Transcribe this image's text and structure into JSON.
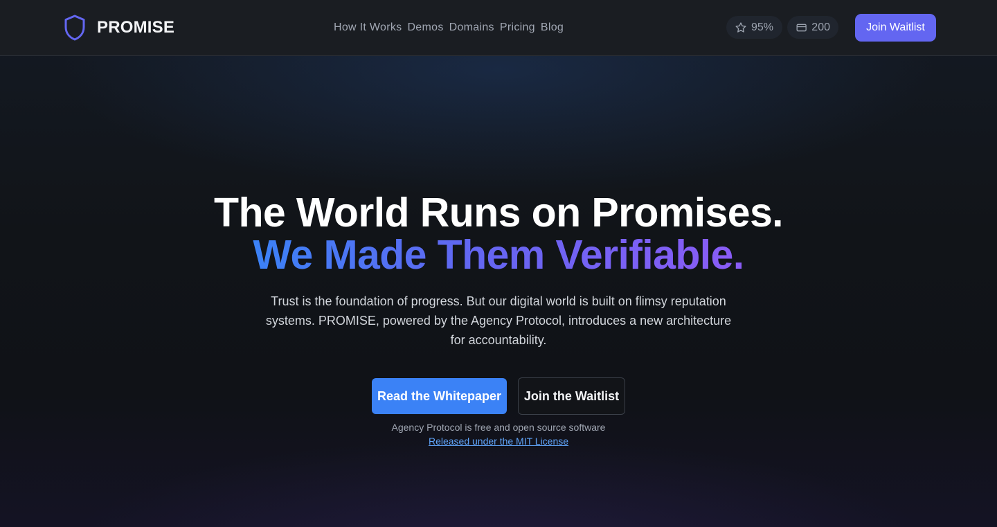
{
  "nav": {
    "brand": "PROMISE",
    "links": [
      "How It Works",
      "Demos",
      "Domains",
      "Pricing",
      "Blog"
    ],
    "rating": "95%",
    "credits": "200",
    "cta": "Join Waitlist"
  },
  "hero": {
    "title_line1": "The World Runs on Promises.",
    "title_line2": "We Made Them Verifiable.",
    "subtitle": "Trust is the foundation of progress. But our digital world is built on flimsy reputation systems. PROMISE, powered by the Agency Protocol, introduces a new architecture for accountability.",
    "primary_button": "Read the Whitepaper",
    "secondary_button": "Join the Waitlist",
    "oss_note": "Agency Protocol is free and open source software",
    "license_link": "Released under the MIT License"
  },
  "colors": {
    "accent": "#6366f1",
    "primary_blue": "#3b82f6",
    "gradient_end": "#8b5cf6",
    "link": "#60a5fa"
  },
  "icons": {
    "brand": "shield-icon",
    "rating": "star-icon",
    "credits": "credit-card-icon"
  }
}
